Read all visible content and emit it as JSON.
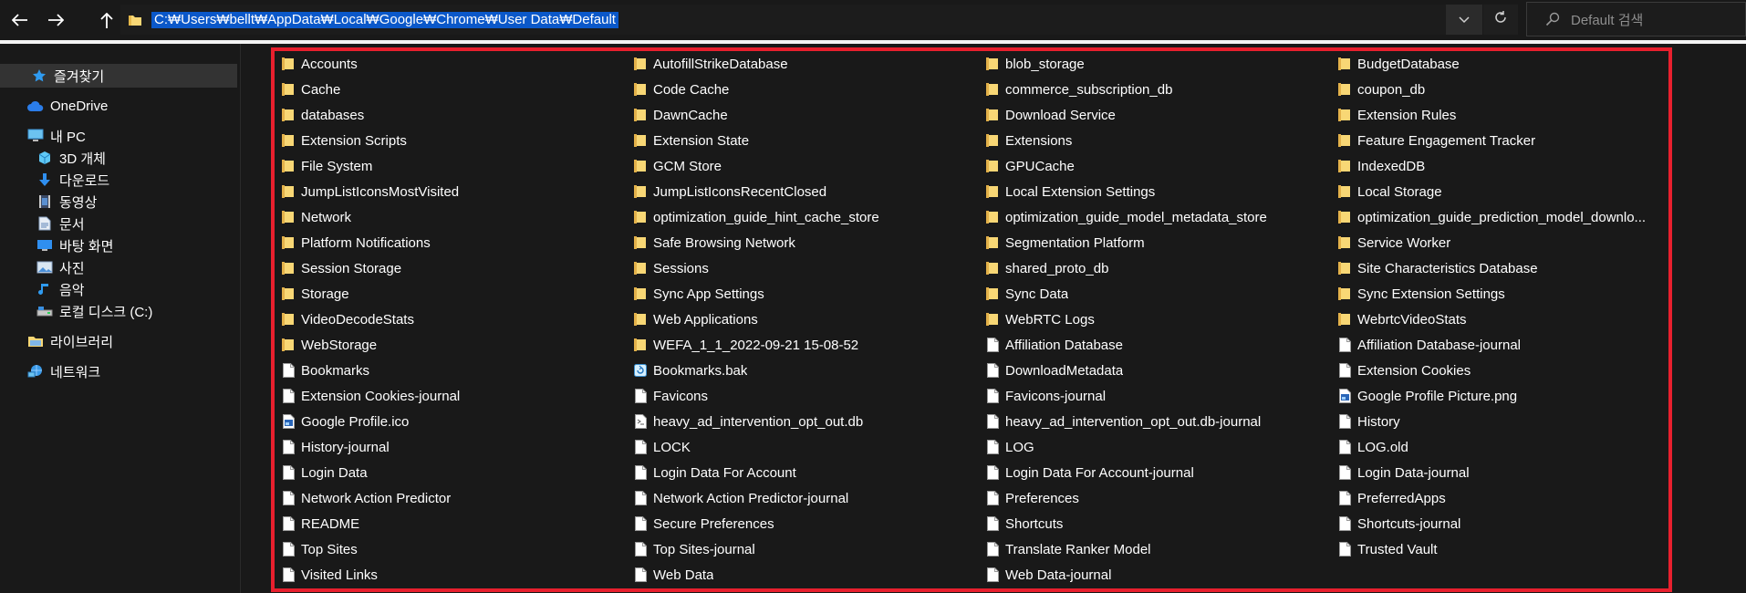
{
  "toolbar": {
    "back_icon": "back-arrow-icon",
    "forward_icon": "forward-arrow-icon",
    "up_icon": "up-arrow-icon"
  },
  "address": {
    "path": "C:₩Users₩bellt₩AppData₩Local₩Google₩Chrome₩User Data₩Default"
  },
  "search": {
    "placeholder": "Default 검색"
  },
  "sidebar": {
    "items": [
      {
        "label": "즐겨찾기",
        "icon": "star-icon"
      },
      {
        "label": "OneDrive",
        "icon": "cloud-icon"
      },
      {
        "label": "내 PC",
        "icon": "computer-icon"
      },
      {
        "label": "3D 개체",
        "icon": "cube-icon"
      },
      {
        "label": "다운로드",
        "icon": "download-icon"
      },
      {
        "label": "동영상",
        "icon": "video-icon"
      },
      {
        "label": "문서",
        "icon": "document-icon"
      },
      {
        "label": "바탕 화면",
        "icon": "desktop-icon"
      },
      {
        "label": "사진",
        "icon": "pictures-icon"
      },
      {
        "label": "음악",
        "icon": "music-icon"
      },
      {
        "label": "로컬 디스크 (C:)",
        "icon": "drive-icon"
      },
      {
        "label": "라이브러리",
        "icon": "library-icon"
      },
      {
        "label": "네트워크",
        "icon": "network-icon"
      }
    ]
  },
  "files": {
    "columns": [
      [
        {
          "name": "Accounts",
          "type": "folder"
        },
        {
          "name": "Cache",
          "type": "folder"
        },
        {
          "name": "databases",
          "type": "folder"
        },
        {
          "name": "Extension Scripts",
          "type": "folder"
        },
        {
          "name": "File System",
          "type": "folder"
        },
        {
          "name": "JumpListIconsMostVisited",
          "type": "folder"
        },
        {
          "name": "Network",
          "type": "folder"
        },
        {
          "name": "Platform Notifications",
          "type": "folder"
        },
        {
          "name": "Session Storage",
          "type": "folder"
        },
        {
          "name": "Storage",
          "type": "folder"
        },
        {
          "name": "VideoDecodeStats",
          "type": "folder"
        },
        {
          "name": "WebStorage",
          "type": "folder"
        },
        {
          "name": "Bookmarks",
          "type": "file"
        },
        {
          "name": "Extension Cookies-journal",
          "type": "file"
        },
        {
          "name": "Google Profile.ico",
          "type": "image"
        },
        {
          "name": "History-journal",
          "type": "file"
        },
        {
          "name": "Login Data",
          "type": "file"
        },
        {
          "name": "Network Action Predictor",
          "type": "file"
        },
        {
          "name": "README",
          "type": "file"
        },
        {
          "name": "Top Sites",
          "type": "file"
        },
        {
          "name": "Visited Links",
          "type": "file"
        }
      ],
      [
        {
          "name": "AutofillStrikeDatabase",
          "type": "folder"
        },
        {
          "name": "Code Cache",
          "type": "folder"
        },
        {
          "name": "DawnCache",
          "type": "folder"
        },
        {
          "name": "Extension State",
          "type": "folder"
        },
        {
          "name": "GCM Store",
          "type": "folder"
        },
        {
          "name": "JumpListIconsRecentClosed",
          "type": "folder"
        },
        {
          "name": "optimization_guide_hint_cache_store",
          "type": "folder"
        },
        {
          "name": "Safe Browsing Network",
          "type": "folder"
        },
        {
          "name": "Sessions",
          "type": "folder"
        },
        {
          "name": "Sync App Settings",
          "type": "folder"
        },
        {
          "name": "Web Applications",
          "type": "folder"
        },
        {
          "name": "WEFA_1_1_2022-09-21 15-08-52",
          "type": "folder"
        },
        {
          "name": "Bookmarks.bak",
          "type": "bak"
        },
        {
          "name": "Favicons",
          "type": "file"
        },
        {
          "name": "heavy_ad_intervention_opt_out.db",
          "type": "db"
        },
        {
          "name": "LOCK",
          "type": "file"
        },
        {
          "name": "Login Data For Account",
          "type": "file"
        },
        {
          "name": "Network Action Predictor-journal",
          "type": "file"
        },
        {
          "name": "Secure Preferences",
          "type": "file"
        },
        {
          "name": "Top Sites-journal",
          "type": "file"
        },
        {
          "name": "Web Data",
          "type": "file"
        }
      ],
      [
        {
          "name": "blob_storage",
          "type": "folder"
        },
        {
          "name": "commerce_subscription_db",
          "type": "folder"
        },
        {
          "name": "Download Service",
          "type": "folder"
        },
        {
          "name": "Extensions",
          "type": "folder"
        },
        {
          "name": "GPUCache",
          "type": "folder"
        },
        {
          "name": "Local Extension Settings",
          "type": "folder"
        },
        {
          "name": "optimization_guide_model_metadata_store",
          "type": "folder"
        },
        {
          "name": "Segmentation Platform",
          "type": "folder"
        },
        {
          "name": "shared_proto_db",
          "type": "folder"
        },
        {
          "name": "Sync Data",
          "type": "folder"
        },
        {
          "name": "WebRTC Logs",
          "type": "folder"
        },
        {
          "name": "Affiliation Database",
          "type": "file"
        },
        {
          "name": "DownloadMetadata",
          "type": "file"
        },
        {
          "name": "Favicons-journal",
          "type": "file"
        },
        {
          "name": "heavy_ad_intervention_opt_out.db-journal",
          "type": "file"
        },
        {
          "name": "LOG",
          "type": "file"
        },
        {
          "name": "Login Data For Account-journal",
          "type": "file"
        },
        {
          "name": "Preferences",
          "type": "file"
        },
        {
          "name": "Shortcuts",
          "type": "file"
        },
        {
          "name": "Translate Ranker Model",
          "type": "file"
        },
        {
          "name": "Web Data-journal",
          "type": "file"
        }
      ],
      [
        {
          "name": "BudgetDatabase",
          "type": "folder"
        },
        {
          "name": "coupon_db",
          "type": "folder"
        },
        {
          "name": "Extension Rules",
          "type": "folder"
        },
        {
          "name": "Feature Engagement Tracker",
          "type": "folder"
        },
        {
          "name": "IndexedDB",
          "type": "folder"
        },
        {
          "name": "Local Storage",
          "type": "folder"
        },
        {
          "name": "optimization_guide_prediction_model_downlo...",
          "type": "folder"
        },
        {
          "name": "Service Worker",
          "type": "folder"
        },
        {
          "name": "Site Characteristics Database",
          "type": "folder"
        },
        {
          "name": "Sync Extension Settings",
          "type": "folder"
        },
        {
          "name": "WebrtcVideoStats",
          "type": "folder"
        },
        {
          "name": "Affiliation Database-journal",
          "type": "file"
        },
        {
          "name": "Extension Cookies",
          "type": "file"
        },
        {
          "name": "Google Profile Picture.png",
          "type": "image"
        },
        {
          "name": "History",
          "type": "file"
        },
        {
          "name": "LOG.old",
          "type": "file"
        },
        {
          "name": "Login Data-journal",
          "type": "file"
        },
        {
          "name": "PreferredApps",
          "type": "file"
        },
        {
          "name": "Shortcuts-journal",
          "type": "file"
        },
        {
          "name": "Trusted Vault",
          "type": "file"
        }
      ]
    ]
  },
  "colors": {
    "background": "#191919",
    "folder": "#f8d775",
    "selection": "#0b58c9",
    "highlight_frame": "#e8202e"
  }
}
